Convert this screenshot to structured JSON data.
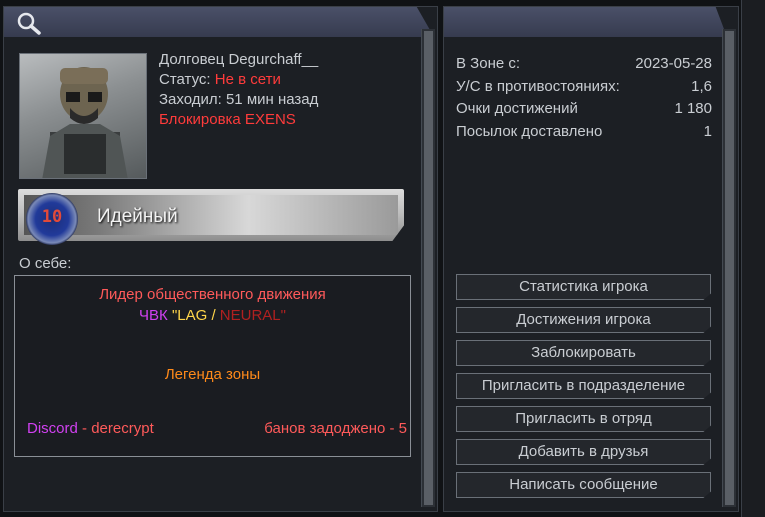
{
  "profile": {
    "name": "Долговец Degurchaff__",
    "status_label": "Статус:",
    "status_value": "Не в сети",
    "last_seen": "Заходил: 51 мин назад",
    "block_text": "Блокировка EXENS"
  },
  "rank": {
    "number": "10",
    "title": "Идейный"
  },
  "about": {
    "label": "О себе:",
    "line1": "Лидер общественного движения",
    "line2_prefix": "ЧВК ",
    "line2_a": "\"LAG / ",
    "line2_b": "NEURAL\"",
    "line3": "Легенда зоны",
    "discord": "Discord",
    "discord_sep": " - ",
    "discord_handle": "derecrypt",
    "bans": "банов задоджено - 5"
  },
  "stats": [
    {
      "label": "В Зоне с:",
      "value": "2023-05-28"
    },
    {
      "label": "У/С в противостояниях:",
      "value": "1,6"
    },
    {
      "label": "Очки достижений",
      "value": "1 180"
    },
    {
      "label": "Посылок доставлено",
      "value": "1"
    }
  ],
  "actions": [
    "Статистика игрока",
    "Достижения игрока",
    "Заблокировать",
    "Пригласить в подразделение",
    "Пригласить в отряд",
    "Добавить в друзья",
    "Написать сообщение"
  ],
  "icons": {
    "search": "search-icon"
  }
}
